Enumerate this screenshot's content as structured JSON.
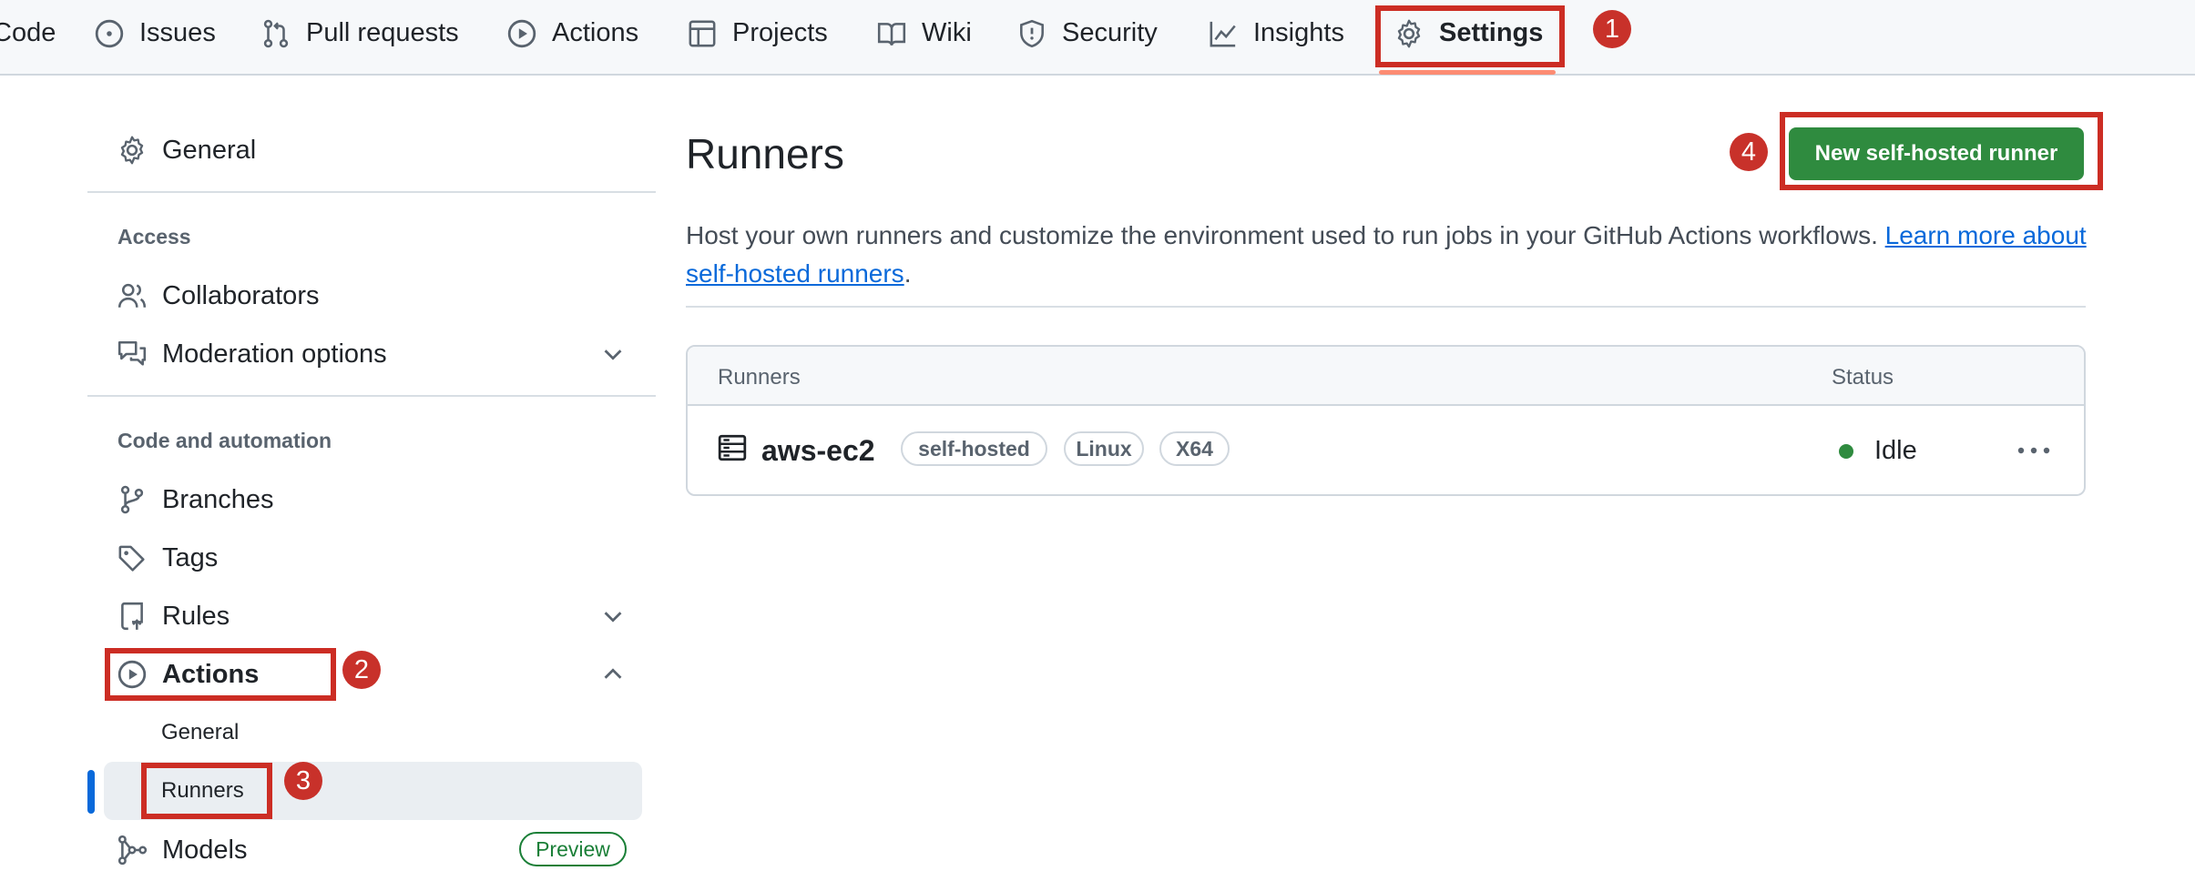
{
  "topnav": {
    "items": [
      {
        "label": "Code",
        "icon": "code-icon"
      },
      {
        "label": "Issues",
        "icon": "issue-opened-icon"
      },
      {
        "label": "Pull requests",
        "icon": "git-pull-request-icon"
      },
      {
        "label": "Actions",
        "icon": "play-icon"
      },
      {
        "label": "Projects",
        "icon": "table-icon"
      },
      {
        "label": "Wiki",
        "icon": "book-icon"
      },
      {
        "label": "Security",
        "icon": "shield-icon"
      },
      {
        "label": "Insights",
        "icon": "graph-icon"
      },
      {
        "label": "Settings",
        "icon": "gear-icon",
        "active": true
      }
    ],
    "active_underline_color": "#fd8c73"
  },
  "annotations": {
    "badges": [
      "1",
      "2",
      "3",
      "4"
    ],
    "color": "#cc2d24"
  },
  "sidebar": {
    "general": "General",
    "access_heading": "Access",
    "collaborators": "Collaborators",
    "moderation": "Moderation options",
    "code_heading": "Code and automation",
    "branches": "Branches",
    "tags": "Tags",
    "rules": "Rules",
    "actions": "Actions",
    "actions_sub": [
      "General",
      "Runners"
    ],
    "models": "Models",
    "models_badge": "Preview"
  },
  "main": {
    "title": "Runners",
    "new_button": "New self-hosted runner",
    "description": "Host your own runners and customize the environment used to run jobs in your GitHub Actions workflows. ",
    "learn_more": "Learn more about self-hosted runners",
    "description_end": ".",
    "table": {
      "headers": [
        "Runners",
        "Status"
      ],
      "rows": [
        {
          "name": "aws-ec2",
          "labels": [
            "self-hosted",
            "Linux",
            "X64"
          ],
          "status": "Idle"
        }
      ]
    }
  },
  "colors": {
    "primary_button": "#2f8b3f",
    "link": "#0969da",
    "selected_marker": "#0969da"
  }
}
